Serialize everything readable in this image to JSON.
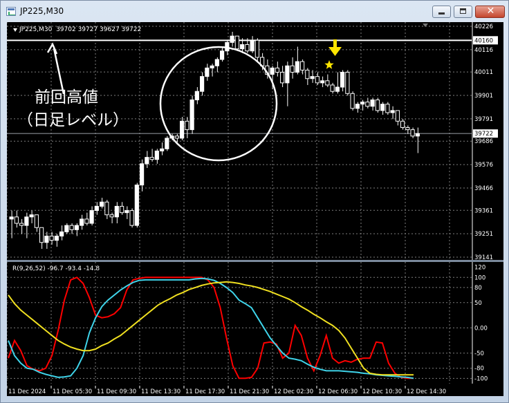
{
  "window": {
    "title": "JP225,M30",
    "buttons": {
      "minimize": "–",
      "maximize": "□",
      "close": "✕"
    }
  },
  "main": {
    "symbol_label": "JP225,M30",
    "ohlc_label": "39702 39727 39627 39722",
    "price_ticks": [
      "40226",
      "40116",
      "40011",
      "39901",
      "39791",
      "39686",
      "39576",
      "39466",
      "39361",
      "39251",
      "39141"
    ],
    "price_range": [
      39141,
      40226
    ],
    "highlight_labels": [
      {
        "price": 40160,
        "text": "40160"
      },
      {
        "price": 39722,
        "text": "39722"
      }
    ],
    "annotation_line1": "前回高値",
    "annotation_line2": "（日足レベル）",
    "colors": {
      "bull": "#ffffff",
      "bear": "#ffffff",
      "grid": "#7f7f7f",
      "marker": "#ffe600"
    },
    "candles": [
      [
        39320,
        39360,
        39230,
        39330
      ],
      [
        39330,
        39360,
        39280,
        39300
      ],
      [
        39300,
        39320,
        39250,
        39290
      ],
      [
        39290,
        39350,
        39230,
        39330
      ],
      [
        39330,
        39360,
        39300,
        39340
      ],
      [
        39340,
        39340,
        39260,
        39280
      ],
      [
        39280,
        39280,
        39180,
        39210
      ],
      [
        39210,
        39260,
        39180,
        39240
      ],
      [
        39240,
        39260,
        39200,
        39220
      ],
      [
        39220,
        39250,
        39190,
        39240
      ],
      [
        39240,
        39290,
        39220,
        39260
      ],
      [
        39260,
        39300,
        39250,
        39290
      ],
      [
        39290,
        39300,
        39250,
        39270
      ],
      [
        39270,
        39300,
        39240,
        39290
      ],
      [
        39290,
        39340,
        39270,
        39320
      ],
      [
        39320,
        39350,
        39290,
        39300
      ],
      [
        39300,
        39380,
        39290,
        39360
      ],
      [
        39360,
        39400,
        39340,
        39380
      ],
      [
        39380,
        39420,
        39370,
        39400
      ],
      [
        39400,
        39410,
        39320,
        39340
      ],
      [
        39340,
        39350,
        39300,
        39330
      ],
      [
        39330,
        39400,
        39300,
        39380
      ],
      [
        39380,
        39400,
        39340,
        39350
      ],
      [
        39350,
        39380,
        39320,
        39360
      ],
      [
        39360,
        39370,
        39280,
        39290
      ],
      [
        39290,
        39490,
        39280,
        39480
      ],
      [
        39480,
        39600,
        39450,
        39580
      ],
      [
        39580,
        39640,
        39560,
        39610
      ],
      [
        39610,
        39650,
        39590,
        39600
      ],
      [
        39600,
        39650,
        39580,
        39640
      ],
      [
        39640,
        39680,
        39620,
        39650
      ],
      [
        39650,
        39710,
        39640,
        39700
      ],
      [
        39700,
        39720,
        39690,
        39710
      ],
      [
        39710,
        39720,
        39680,
        39700
      ],
      [
        39700,
        39800,
        39690,
        39780
      ],
      [
        39780,
        39800,
        39700,
        39740
      ],
      [
        39740,
        39900,
        39720,
        39880
      ],
      [
        39880,
        39940,
        39860,
        39920
      ],
      [
        39920,
        40010,
        39900,
        39990
      ],
      [
        39990,
        40050,
        39970,
        40030
      ],
      [
        40030,
        40050,
        39990,
        40040
      ],
      [
        40040,
        40080,
        40010,
        40070
      ],
      [
        40070,
        40130,
        40060,
        40110
      ],
      [
        40110,
        40160,
        40090,
        40150
      ],
      [
        40150,
        40200,
        40130,
        40180
      ],
      [
        40180,
        40180,
        40110,
        40120
      ],
      [
        40120,
        40170,
        40100,
        40140
      ],
      [
        40140,
        40170,
        40100,
        40110
      ],
      [
        40110,
        40180,
        40100,
        40160
      ],
      [
        40160,
        40170,
        40060,
        40080
      ],
      [
        40080,
        40100,
        40020,
        40040
      ],
      [
        40040,
        40070,
        39980,
        40000
      ],
      [
        40000,
        40040,
        39930,
        40030
      ],
      [
        40030,
        40060,
        39990,
        40010
      ],
      [
        40010,
        40040,
        39940,
        39960
      ],
      [
        39960,
        40060,
        39850,
        40040
      ],
      [
        40040,
        40080,
        39980,
        40010
      ],
      [
        40010,
        40130,
        40000,
        40060
      ],
      [
        40060,
        40070,
        40000,
        40020
      ],
      [
        40020,
        40030,
        39950,
        39980
      ],
      [
        39980,
        40020,
        39960,
        39990
      ],
      [
        39990,
        40010,
        39950,
        39960
      ],
      [
        39960,
        39990,
        39940,
        39970
      ],
      [
        39970,
        40000,
        39940,
        39950
      ],
      [
        39950,
        39960,
        39910,
        39920
      ],
      [
        39920,
        40010,
        39910,
        39940
      ],
      [
        39940,
        40020,
        39920,
        40010
      ],
      [
        40010,
        40020,
        39900,
        39910
      ],
      [
        39910,
        39920,
        39830,
        39840
      ],
      [
        39840,
        39870,
        39820,
        39860
      ],
      [
        39860,
        39880,
        39830,
        39870
      ],
      [
        39870,
        39890,
        39840,
        39850
      ],
      [
        39850,
        39890,
        39830,
        39880
      ],
      [
        39880,
        39890,
        39820,
        39830
      ],
      [
        39830,
        39870,
        39810,
        39860
      ],
      [
        39860,
        39870,
        39810,
        39820
      ],
      [
        39820,
        39850,
        39790,
        39830
      ],
      [
        39830,
        39830,
        39760,
        39780
      ],
      [
        39780,
        39790,
        39740,
        39750
      ],
      [
        39750,
        39760,
        39720,
        39740
      ],
      [
        39740,
        39750,
        39700,
        39710
      ],
      [
        39710,
        39750,
        39630,
        39722
      ]
    ]
  },
  "oscillator": {
    "label": "R(9,26,52) -96.7 -93.4 -14.8",
    "ticks": [
      "120",
      "100",
      "80",
      "50",
      "0.00",
      "-50",
      "-80",
      "-100"
    ],
    "range": [
      -105,
      125
    ],
    "levels": [
      100,
      80,
      50,
      0,
      -50,
      -80,
      -100
    ],
    "series": [
      {
        "color": "#ff0000",
        "values": [
          -60,
          -25,
          -45,
          -75,
          -82,
          -85,
          -80,
          -55,
          -5,
          55,
          95,
          100,
          88,
          60,
          25,
          20,
          22,
          28,
          40,
          75,
          95,
          98,
          100,
          100,
          100,
          100,
          100,
          100,
          100,
          100,
          100,
          100,
          95,
          80,
          40,
          -20,
          -75,
          -100,
          -100,
          -98,
          -80,
          -30,
          -28,
          -32,
          -60,
          -50,
          5,
          -15,
          -60,
          -85,
          -55,
          -15,
          -60,
          -70,
          -65,
          -68,
          -62,
          -60,
          -60,
          -28,
          -30,
          -70,
          -90,
          -98,
          -100,
          -100
        ]
      },
      {
        "color": "#3fd4ea",
        "values": [
          -25,
          -55,
          -70,
          -80,
          -82,
          -88,
          -92,
          -95,
          -98,
          -97,
          -95,
          -80,
          -55,
          -10,
          20,
          42,
          55,
          65,
          75,
          83,
          90,
          94,
          95,
          95,
          95,
          95,
          95,
          95,
          95,
          95,
          97,
          98,
          97,
          94,
          88,
          80,
          70,
          55,
          48,
          40,
          20,
          0,
          -20,
          -35,
          -50,
          -60,
          -62,
          -65,
          -72,
          -78,
          -82,
          -85,
          -85,
          -85,
          -86,
          -87,
          -88,
          -90,
          -91,
          -93,
          -94,
          -95,
          -96,
          -97,
          -98,
          -100
        ]
      },
      {
        "color": "#f0e020",
        "values": [
          65,
          48,
          35,
          25,
          15,
          5,
          -5,
          -15,
          -25,
          -32,
          -38,
          -42,
          -45,
          -45,
          -42,
          -35,
          -30,
          -22,
          -15,
          -5,
          5,
          15,
          25,
          35,
          45,
          52,
          58,
          65,
          70,
          76,
          80,
          84,
          87,
          89,
          90,
          91,
          90,
          88,
          85,
          83,
          80,
          76,
          72,
          67,
          62,
          57,
          50,
          42,
          35,
          27,
          20,
          12,
          5,
          -5,
          -20,
          -40,
          -60,
          -80,
          -90,
          -92,
          -93,
          -93,
          -93,
          -93,
          -93,
          -93
        ]
      }
    ]
  },
  "time_labels": [
    "11 Dec 2024",
    "11 Dec 05:30",
    "11 Dec 09:30",
    "11 Dec 13:30",
    "11 Dec 17:30",
    "11 Dec 21:30",
    "12 Dec 02:30",
    "12 Dec 06:30",
    "12 Dec 10:30",
    "12 Dec 14:30"
  ]
}
